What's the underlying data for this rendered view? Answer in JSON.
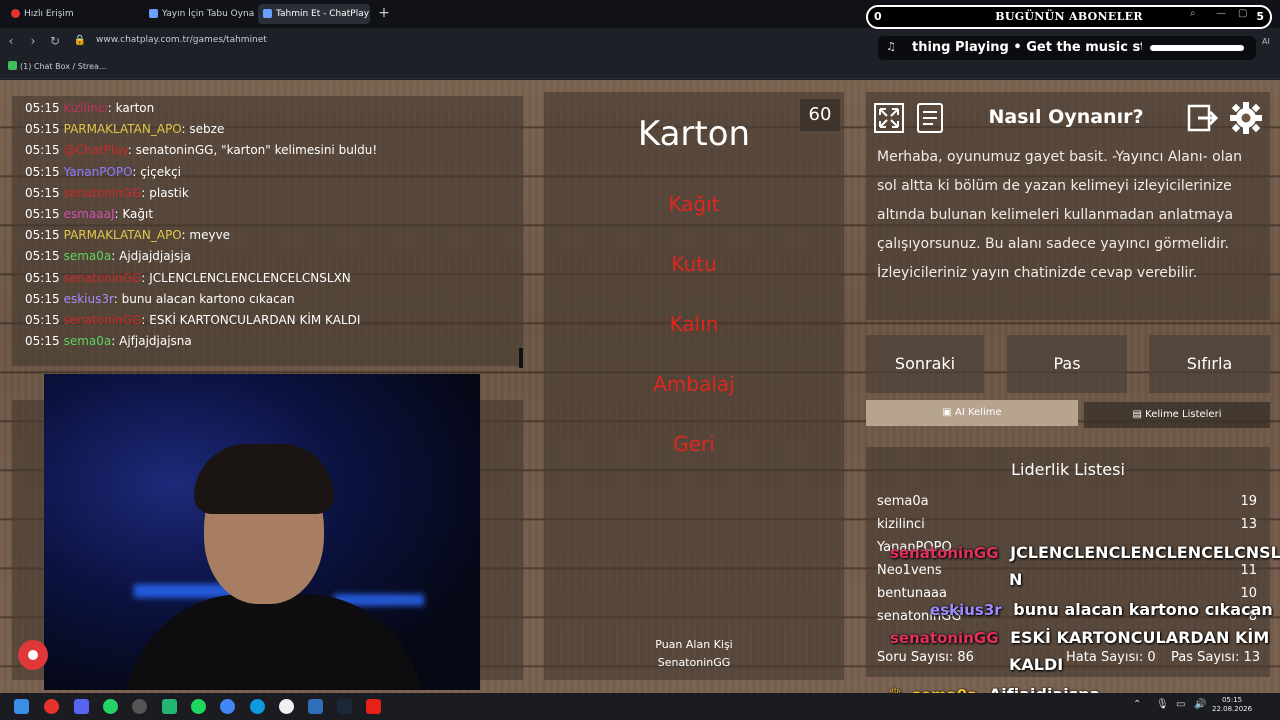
{
  "browser": {
    "tabs": [
      {
        "label": "Hızlı Erişim",
        "icon_color": "#e5322d"
      },
      {
        "label": "Yayın İçin Tabu Oyna",
        "icon_color": "#6aa0ff"
      },
      {
        "label": "Tahmin Et - ChatPlay",
        "icon_color": "#6aa0ff"
      }
    ],
    "url": "www.chatplay.com.tr/games/tahminet",
    "bookmark": "(1) Chat Box / Strea..."
  },
  "subscriber_banner": {
    "count": "0",
    "title": "BUGÜNÜN ABONELER",
    "right": "5"
  },
  "music_widget": {
    "text": "thing Playing  •  Get the music sto",
    "ai": "AI"
  },
  "chat": [
    {
      "time": "05:15",
      "user": "kizilinci",
      "color": "#c4305c",
      "msg": ": karton"
    },
    {
      "time": "05:15",
      "user": "PARMAKLATAN_APO",
      "color": "#e2c84a",
      "msg": ": sebze"
    },
    {
      "time": "05:15",
      "user": "@ChatPlay",
      "color": "#c92a2a",
      "msg": ": senatoninGG, \"karton\" kelimesini buldu!"
    },
    {
      "time": "05:15",
      "user": "YananPOPO",
      "color": "#8a7cff",
      "msg": ": çiçekçi"
    },
    {
      "time": "05:15",
      "user": "senatoninGG",
      "color": "#c92a2a",
      "msg": ": plastik"
    },
    {
      "time": "05:15",
      "user": "esmaaaJ",
      "color": "#d24fb4",
      "msg": ": Kağıt"
    },
    {
      "time": "05:15",
      "user": "PARMAKLATAN_APO",
      "color": "#e2c84a",
      "msg": ": meyve"
    },
    {
      "time": "05:15",
      "user": "sema0a",
      "color": "#5fd35f",
      "msg": ": Ajdjajdjajsja"
    },
    {
      "time": "05:15",
      "user": "senatoninGG",
      "color": "#c92a2a",
      "msg": ": JCLENCLENCLENCLENCELCNSLXN"
    },
    {
      "time": "05:15",
      "user": "eskius3r",
      "color": "#a58cff",
      "msg": ": bunu alacan kartono cıkacan"
    },
    {
      "time": "05:15",
      "user": "senatoninGG",
      "color": "#c92a2a",
      "msg": ": ESKİ KARTONCULARDAN KİM KALDI"
    },
    {
      "time": "05:15",
      "user": "sema0a",
      "color": "#5fd35f",
      "msg": ": Ajfjajdjajsna"
    }
  ],
  "game": {
    "word": "Karton",
    "timer": "60",
    "taboo_words": [
      "Kağıt",
      "Kutu",
      "Kalın",
      "Ambalaj",
      "Geri"
    ],
    "scorer_label": "Puan Alan Kişi",
    "scorer_name": "SenatoninGG"
  },
  "howto": {
    "title": "Nasıl Oynanır?",
    "text": "Merhaba, oyunumuz gayet basit. -Yayıncı Alanı- olan sol altta ki bölüm de yazan kelimeyi izleyicilerinize altında bulunan kelimeleri kullanmadan anlatmaya çalışıyorsunuz. Bu alanı sadece yayıncı görmelidir. İzleyicileriniz yayın chatinizde cevap verebilir."
  },
  "controls": {
    "next": "Sonraki",
    "pass": "Pas",
    "reset": "Sıfırla",
    "tab_ai": "AI Kelime",
    "tab_lists": "Kelime Listeleri"
  },
  "leaderboard": {
    "title": "Liderlik Listesi",
    "rows": [
      {
        "name": "sema0a",
        "score": "19"
      },
      {
        "name": "kizilinci",
        "score": "13"
      },
      {
        "name": "YananPOPO",
        "score": ""
      },
      {
        "name": "Neo1vens",
        "score": "11"
      },
      {
        "name": "bentunaaa",
        "score": "10"
      },
      {
        "name": "senatoninGG",
        "score": "8"
      }
    ]
  },
  "stats": {
    "questions": "Soru Sayısı: 86",
    "errors": "Hata Sayısı: 0",
    "passes": "Pas Sayısı: 13"
  },
  "overlay_chat": [
    {
      "user": "senatoninGG",
      "color": "#e0305c",
      "msg": "JCLENCLENCLENCLENCELCNSLX"
    },
    {
      "user": "",
      "color": "#e0305c",
      "msg": "N"
    },
    {
      "user": "eskius3r",
      "color": "#9d8cff",
      "msg": "bunu alacan kartono cıkacan"
    },
    {
      "user": "senatoninGG",
      "color": "#e0305c",
      "msg": "ESKİ KARTONCULARDAN KİM"
    },
    {
      "user": "",
      "color": "#e0305c",
      "msg": "KALDI"
    },
    {
      "user": "sema0a",
      "color": "#f2c230",
      "msg": "Ajfjajdjajsna"
    }
  ],
  "taskbar": {
    "time": "05:15",
    "date": "22.08.2026"
  }
}
